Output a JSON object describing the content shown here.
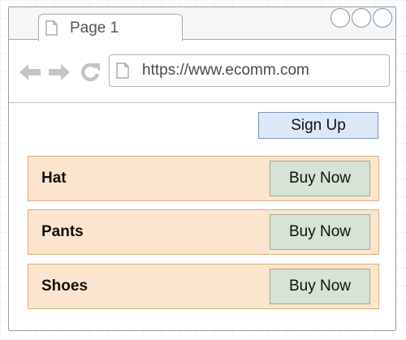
{
  "browser": {
    "tab": {
      "label": "Page 1",
      "icon": "document-icon"
    },
    "window_controls": [
      "minimize",
      "maximize",
      "close"
    ],
    "nav": {
      "back_icon": "back-arrow-icon",
      "forward_icon": "forward-arrow-icon",
      "reload_icon": "reload-icon"
    },
    "url": {
      "value": "https://www.ecomm.com",
      "icon": "document-icon"
    }
  },
  "page": {
    "signup_label": "Sign Up",
    "products": [
      {
        "name": "Hat",
        "button_label": "Buy Now"
      },
      {
        "name": "Pants",
        "button_label": "Buy Now"
      },
      {
        "name": "Shoes",
        "button_label": "Buy Now"
      }
    ]
  },
  "colors": {
    "product_row_bg": "#fbe5cf",
    "product_row_border": "#d9b17d",
    "buy_button_bg": "#d7e3d5",
    "signup_button_bg": "#dce7f7",
    "active_window_control": "#5a9bd5"
  }
}
